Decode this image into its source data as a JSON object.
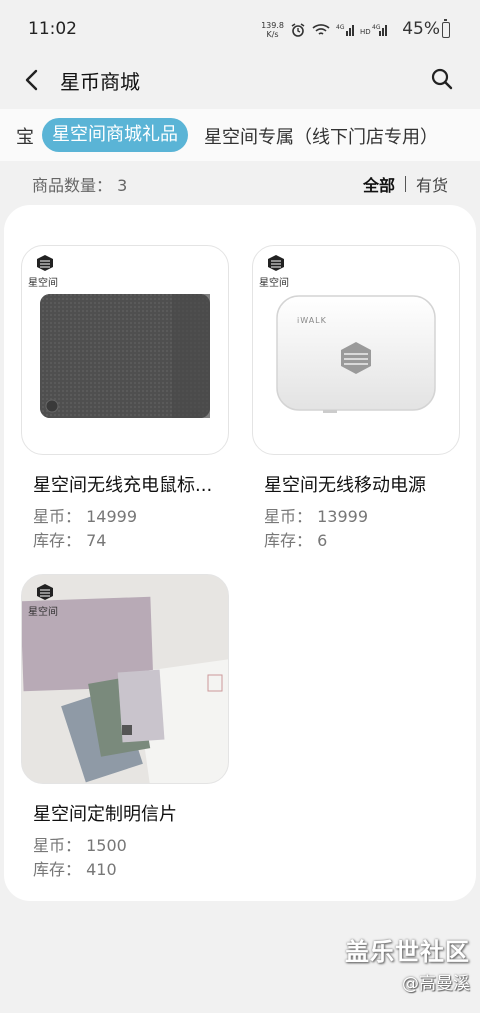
{
  "status": {
    "time": "11:02",
    "net_speed_value": "139.8",
    "net_speed_unit": "K/s",
    "battery": "45%"
  },
  "header": {
    "title": "星币商城"
  },
  "tabs": {
    "prev": "宝",
    "active": "星空间商城礼品",
    "next": "星空间专属（线下门店专用）"
  },
  "summary": {
    "count_label": "商品数量：",
    "count_value": "3"
  },
  "filters": {
    "all": "全部",
    "in_stock": "有货"
  },
  "products": [
    {
      "name": "星空间无线充电鼠标...",
      "price_label": "星币：",
      "price": "14999",
      "stock_label": "库存：",
      "stock": "74"
    },
    {
      "name": "星空间无线移动电源",
      "price_label": "星币：",
      "price": "13999",
      "stock_label": "库存：",
      "stock": "6",
      "brand": "iWALK"
    },
    {
      "name": "星空间定制明信片",
      "price_label": "星币：",
      "price": "1500",
      "stock_label": "库存：",
      "stock": "410"
    }
  ],
  "logo_text": "星空间",
  "watermark": {
    "main": "盖乐世社区",
    "sub": "@高曼溪"
  },
  "colors": {
    "accent": "#5ab4d6",
    "background": "#f1f1f1",
    "panel": "#ffffff"
  }
}
